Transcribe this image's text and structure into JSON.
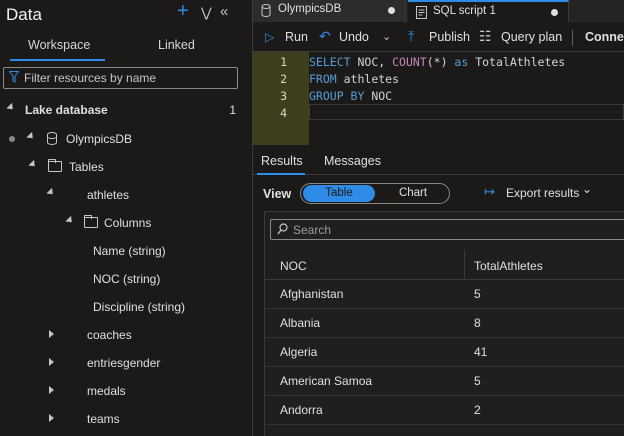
{
  "left_panel": {
    "title": "Data",
    "tabs": [
      {
        "label": "Workspace",
        "active": true
      },
      {
        "label": "Linked",
        "active": false
      }
    ],
    "filter_placeholder": "Filter resources by name",
    "tree": {
      "lake_database": {
        "label": "Lake database",
        "count": "1"
      },
      "database": {
        "label": "OlympicsDB"
      },
      "tables_label": "Tables",
      "table_athletes": "athletes",
      "columns_label": "Columns",
      "columns": [
        "Name (string)",
        "NOC (string)",
        "Discipline (string)"
      ],
      "other_tables": [
        "coaches",
        "entriesgender",
        "medals",
        "teams"
      ]
    }
  },
  "doc_tabs": [
    {
      "label": "OlympicsDB"
    },
    {
      "label": "SQL script 1",
      "active": true
    }
  ],
  "toolbar": {
    "run": "Run",
    "undo": "Undo",
    "publish": "Publish",
    "query_plan": "Query plan",
    "connect": "Connec"
  },
  "editor": {
    "line_numbers": [
      "1",
      "2",
      "3",
      "4"
    ],
    "lines": {
      "l1_select": "SELECT",
      "l1_cols": " NOC, ",
      "l1_fn": "COUNT",
      "l1_arg": "(*)",
      "l1_as": " as ",
      "l1_alias": "TotalAthletes",
      "l2_from": "FROM",
      "l2_table": " athletes",
      "l3_group": "GROUP BY",
      "l3_col": " NOC"
    }
  },
  "results": {
    "tabs": [
      {
        "label": "Results",
        "active": true
      },
      {
        "label": "Messages",
        "active": false
      }
    ],
    "view_label": "View",
    "view_options": [
      {
        "label": "Table",
        "active": true
      },
      {
        "label": "Chart",
        "active": false
      }
    ],
    "export_label": "Export results",
    "search_placeholder": "Search",
    "columns": [
      "NOC",
      "TotalAthletes"
    ],
    "rows": [
      [
        "Afghanistan",
        "5"
      ],
      [
        "Albania",
        "8"
      ],
      [
        "Algeria",
        "41"
      ],
      [
        "American Samoa",
        "5"
      ],
      [
        "Andorra",
        "2"
      ]
    ]
  },
  "colors": {
    "accent": "#2e8ce6",
    "background": "#1b1a19",
    "gutter": "#3f3f1d",
    "keyword": "#569cd6"
  }
}
